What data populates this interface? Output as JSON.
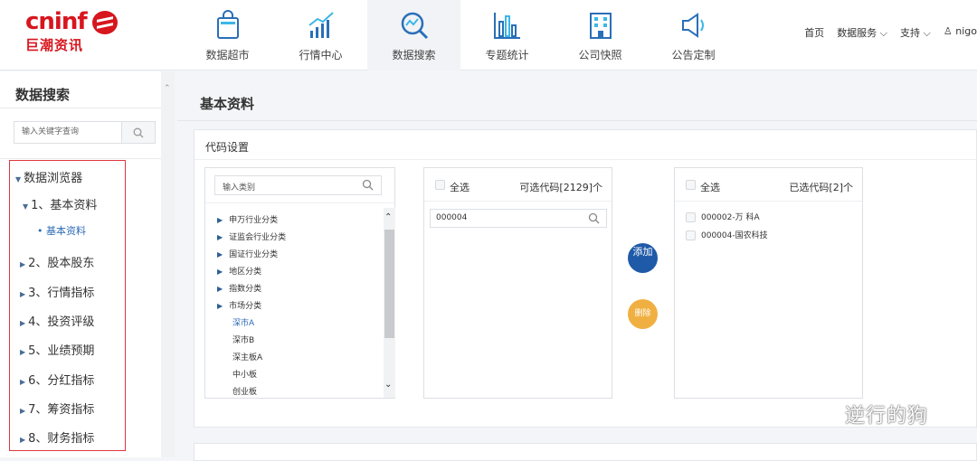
{
  "logo": {
    "en": "cninf",
    "cn": "巨潮资讯"
  },
  "nav": [
    {
      "label": "数据超市",
      "icon": "shopping-bag-icon"
    },
    {
      "label": "行情中心",
      "icon": "trend-chart-icon"
    },
    {
      "label": "数据搜索",
      "icon": "search-chart-icon",
      "active": true
    },
    {
      "label": "专题统计",
      "icon": "bar-chart-icon"
    },
    {
      "label": "公司快照",
      "icon": "building-icon"
    },
    {
      "label": "公告定制",
      "icon": "megaphone-icon"
    }
  ],
  "top_links": {
    "home": "首页",
    "data_service": "数据服务",
    "support": "支持",
    "user": "nigo"
  },
  "sidebar": {
    "title": "数据搜索",
    "search_placeholder": "输入关键字查询",
    "tree": [
      {
        "label": "数据浏览器",
        "level": 0,
        "expanded": true
      },
      {
        "label": "1、基本资料",
        "level": 1,
        "expanded": true
      },
      {
        "label": "基本资料",
        "level": 2
      },
      {
        "label": "2、股本股东",
        "level": 1
      },
      {
        "label": "3、行情指标",
        "level": 1
      },
      {
        "label": "4、投资评级",
        "level": 1
      },
      {
        "label": "5、业绩预期",
        "level": 1
      },
      {
        "label": "6、分红指标",
        "level": 1
      },
      {
        "label": "7、筹资指标",
        "level": 1
      },
      {
        "label": "8、财务指标",
        "level": 1
      }
    ]
  },
  "main": {
    "title": "基本资料",
    "panel_title": "代码设置",
    "category": {
      "placeholder": "输入类别",
      "items": [
        {
          "label": "申万行业分类",
          "type": "group"
        },
        {
          "label": "证监会行业分类",
          "type": "group"
        },
        {
          "label": "国证行业分类",
          "type": "group"
        },
        {
          "label": "地区分类",
          "type": "group"
        },
        {
          "label": "指数分类",
          "type": "group"
        },
        {
          "label": "市场分类",
          "type": "group"
        },
        {
          "label": "深市A",
          "type": "selected"
        },
        {
          "label": "深市B",
          "type": "sub"
        },
        {
          "label": "深主板A",
          "type": "sub"
        },
        {
          "label": "中小板",
          "type": "sub"
        },
        {
          "label": "创业板",
          "type": "sub"
        }
      ]
    },
    "available": {
      "select_all": "全选",
      "count_label": "可选代码[2129]个",
      "search_value": "000004"
    },
    "actions": {
      "add": "添加",
      "delete": "删除"
    },
    "selected": {
      "select_all": "全选",
      "count_label": "已选代码[2]个",
      "items": [
        "000002-万 科A",
        "000004-国农科技"
      ]
    }
  },
  "watermark": "逆行的狗"
}
